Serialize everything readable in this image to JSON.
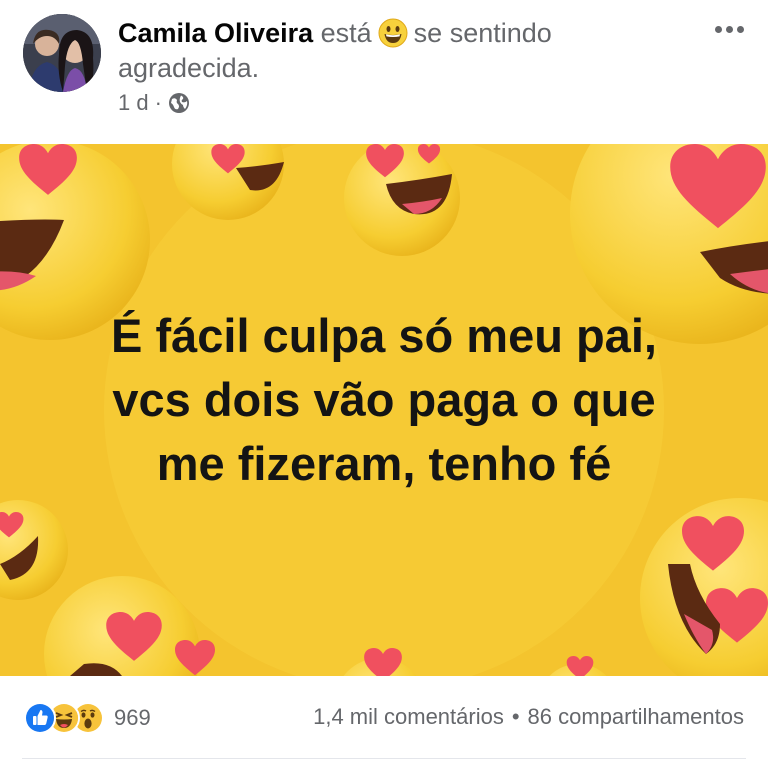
{
  "post": {
    "author": "Camila Oliveira",
    "status_prefix": "está",
    "feeling_icon": "grinning-emoji",
    "status_suffix": "se sentindo",
    "feeling": "agradecida.",
    "time": "1 d",
    "separator": "·",
    "audience_icon": "globe-icon",
    "more_icon": "more-options-icon"
  },
  "image": {
    "background_color": "#f4c42e",
    "lines": [
      "É fácil culpa só meu pai,",
      "vcs dois vão paga o que",
      "me fizeram, tenho fé"
    ]
  },
  "footer": {
    "reaction_icons": [
      "like-icon",
      "haha-icon",
      "wow-icon"
    ],
    "reaction_count": "969",
    "comments": "1,4 mil comentários",
    "bullet": "•",
    "shares": "86 compartilhamentos"
  },
  "colors": {
    "accent": "#1877f2",
    "secondary_text": "#65676b",
    "emoji_yellow": "#f7d13c",
    "heart_red": "#f0505f"
  }
}
